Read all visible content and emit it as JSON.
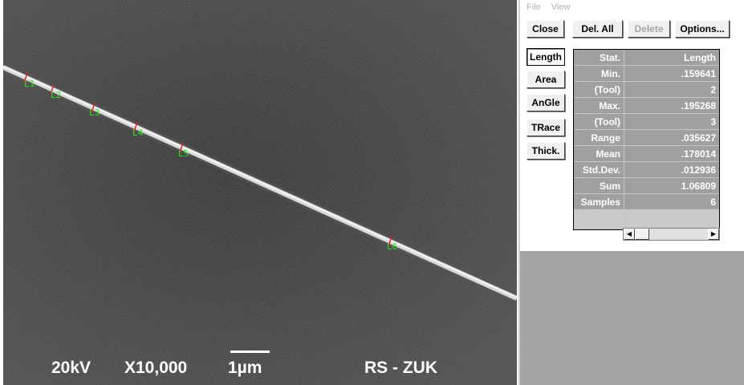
{
  "image": {
    "captions": {
      "voltage": "20kV",
      "magnification": "X10,000",
      "scale": "1µm",
      "label": "RS - ZUK"
    },
    "markers": [
      "L1",
      "L2",
      "L3",
      "L4",
      "L5",
      "L6"
    ]
  },
  "menu": {
    "items": [
      "File",
      "View"
    ]
  },
  "toolbar": {
    "close": "Close",
    "del_all": "Del. All",
    "delete": "Delete",
    "options": "Options..."
  },
  "tools": {
    "length": "Length",
    "area": "Area",
    "angle": "AnGle",
    "trace": "TRace",
    "thick": "Thick."
  },
  "stats": {
    "header": {
      "stat": "Stat.",
      "value": "Length"
    },
    "rows": [
      {
        "label": "Min.",
        "value": ".159641"
      },
      {
        "label": "(Tool)",
        "value": "2"
      },
      {
        "label": "Max.",
        "value": ".195268"
      },
      {
        "label": "(Tool)",
        "value": "3"
      },
      {
        "label": "Range",
        "value": ".035627"
      },
      {
        "label": "Mean",
        "value": ".178014"
      },
      {
        "label": "Std.Dev.",
        "value": ".012936"
      },
      {
        "label": "Sum",
        "value": "1.06809"
      },
      {
        "label": "Samples",
        "value": "6"
      }
    ]
  },
  "colors": {
    "marker": "#27e81f",
    "marker_tick": "#e02020",
    "panel_gray": "#a3a3a3",
    "table_cell": "#a0a0a0"
  }
}
